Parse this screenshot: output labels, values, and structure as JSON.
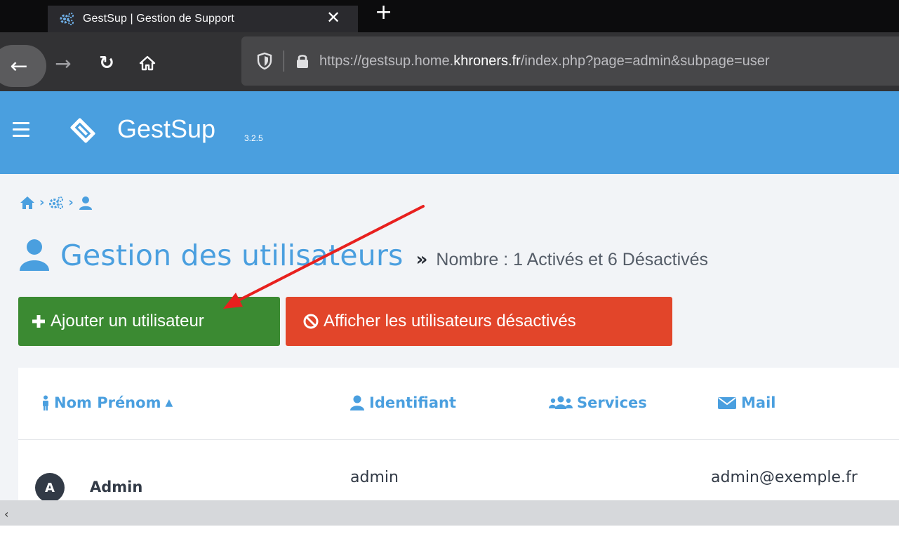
{
  "browser": {
    "tab_title": "GestSup | Gestion de Support",
    "url_prefix": "https://gestsup.home.",
    "url_domain": "khroners.fr",
    "url_suffix": "/index.php?page=admin&subpage=user"
  },
  "app": {
    "brand": "GestSup",
    "version": "3.2.5"
  },
  "page": {
    "title": "Gestion des utilisateurs",
    "subtitle": "Nombre : 1 Activés et 6 Désactivés",
    "raquo": "»"
  },
  "buttons": {
    "add_user": "Ajouter un utilisateur",
    "show_disabled": "Afficher les utilisateurs désactivés"
  },
  "table": {
    "columns": [
      "Nom Prénom",
      "Identifiant",
      "Services",
      "Mail"
    ],
    "rows": [
      {
        "avatar": "A",
        "name": "Admin",
        "login": "admin",
        "services": "",
        "mail": "admin@exemple.fr"
      }
    ]
  },
  "colors": {
    "accent": "#4a9fdf",
    "success": "#3b8a32",
    "danger": "#e2452a",
    "annotation": "#e8201e"
  }
}
